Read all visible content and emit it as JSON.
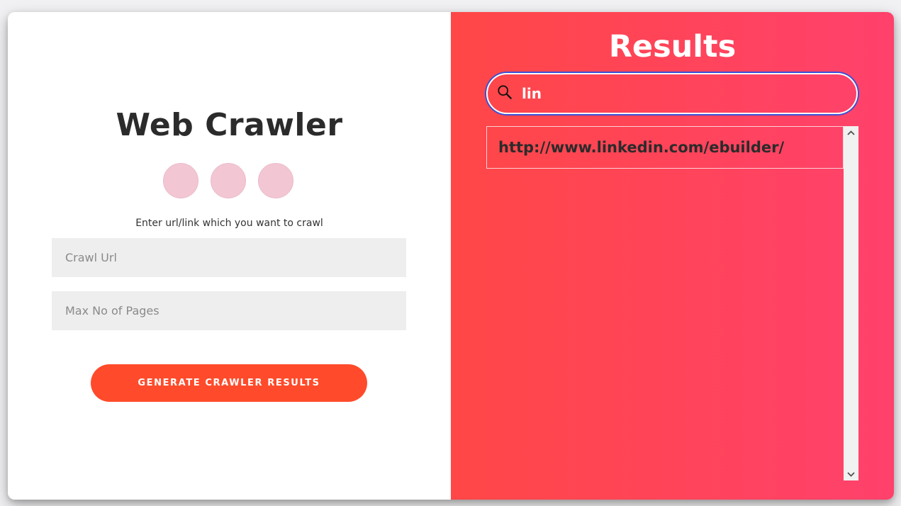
{
  "crawler": {
    "title": "Web Crawler",
    "social_icons": [
      "facebook-icon",
      "google-plus-icon",
      "linkedin-icon"
    ],
    "hint": "Enter url/link which you want to crawl",
    "url_placeholder": "Crawl Url",
    "pages_placeholder": "Max No of Pages",
    "button_label": "Generate Crawler Results"
  },
  "results": {
    "title": "Results",
    "search_value": "lin",
    "items": [
      {
        "url": "http://www.linkedin.com/ebuilder/"
      }
    ]
  },
  "colors": {
    "accent": "#ff4b2b",
    "panel_gradient_start": "#ff4747",
    "panel_gradient_end": "#ff416c",
    "social_circle": "#f3c6d3",
    "input_bg": "#eeeeee",
    "search_focus": "#3b4fd6"
  },
  "icons": {
    "search": "search-icon",
    "scroll_up": "chevron-up-icon",
    "scroll_down": "chevron-down-icon"
  }
}
